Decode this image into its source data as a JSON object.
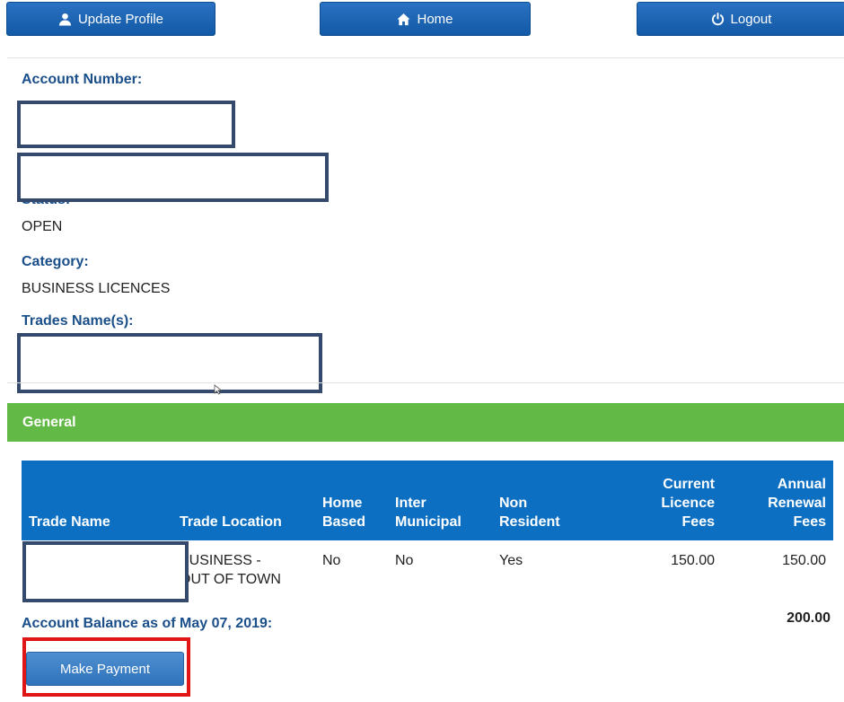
{
  "nav": {
    "update_profile": "Update Profile",
    "home": "Home",
    "logout": "Logout"
  },
  "account": {
    "account_number_label": "Account Number:",
    "status_label": "Status:",
    "status_value": "OPEN",
    "category_label": "Category:",
    "category_value": "BUSINESS LICENCES",
    "trades_names_label": "Trades Name(s):"
  },
  "section": {
    "general": "General"
  },
  "table": {
    "headers": {
      "trade_name": "Trade Name",
      "trade_location": "Trade Location",
      "home_based_1": "Home",
      "home_based_2": "Based",
      "inter_municipal_1": "Inter",
      "inter_municipal_2": "Municipal",
      "non_resident_1": "Non",
      "non_resident_2": "Resident",
      "current_fees_1": "Current",
      "current_fees_2": "Licence",
      "current_fees_3": "Fees",
      "annual_fees_1": "Annual",
      "annual_fees_2": "Renewal",
      "annual_fees_3": "Fees"
    },
    "rows": [
      {
        "trade_location_1": "BUSINESS -",
        "trade_location_2": "OUT OF TOWN",
        "home_based": "No",
        "inter_municipal": "No",
        "non_resident": "Yes",
        "current_fees": "150.00",
        "annual_fees": "150.00"
      }
    ]
  },
  "balance": {
    "label": "Account Balance as of May 07, 2019:",
    "value": "200.00"
  },
  "actions": {
    "make_payment": "Make Payment"
  },
  "colors": {
    "nav_button": "#1a65b3",
    "label_text": "#1a4f8a",
    "section_bar": "#62b945",
    "table_header": "#0d6fc2",
    "redaction_border": "#34496b",
    "highlight_outline": "#e01616"
  }
}
